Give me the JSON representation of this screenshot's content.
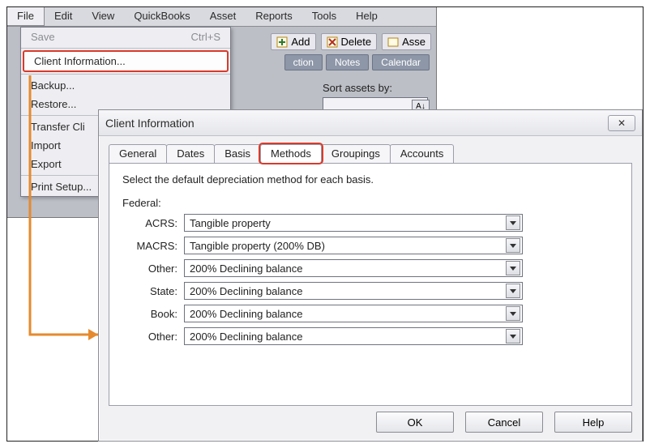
{
  "menubar": [
    "File",
    "Edit",
    "View",
    "QuickBooks",
    "Asset",
    "Reports",
    "Tools",
    "Help"
  ],
  "file_menu": {
    "save_label": "Save",
    "save_accel": "Ctrl+S",
    "client_info": "Client Information...",
    "backup": "Backup...",
    "restore": "Restore...",
    "transfer": "Transfer Cli",
    "import": "Import",
    "export": "Export",
    "print_setup": "Print Setup..."
  },
  "toolbar": {
    "add": "Add",
    "delete": "Delete",
    "asset": "Asse"
  },
  "subtabs": {
    "a": "ction",
    "b": "Notes",
    "c": "Calendar"
  },
  "sort": {
    "label": "Sort assets by:",
    "az": "A↓"
  },
  "dialog": {
    "title": "Client Information",
    "tabs": [
      "General",
      "Dates",
      "Basis",
      "Methods",
      "Groupings",
      "Accounts"
    ],
    "active_tab": "Methods",
    "instruction": "Select the default depreciation method for each basis.",
    "federal_label": "Federal:",
    "fields": {
      "acrs": {
        "label": "ACRS:",
        "value": "Tangible property"
      },
      "macrs": {
        "label": "MACRS:",
        "value": "Tangible property (200% DB)"
      },
      "other1": {
        "label": "Other:",
        "value": "200% Declining balance"
      },
      "state": {
        "label": "State:",
        "value": "200% Declining balance"
      },
      "book": {
        "label": "Book:",
        "value": "200% Declining balance"
      },
      "other2": {
        "label": "Other:",
        "value": "200% Declining balance"
      }
    },
    "buttons": {
      "ok": "OK",
      "cancel": "Cancel",
      "help": "Help"
    },
    "close": "✕"
  }
}
